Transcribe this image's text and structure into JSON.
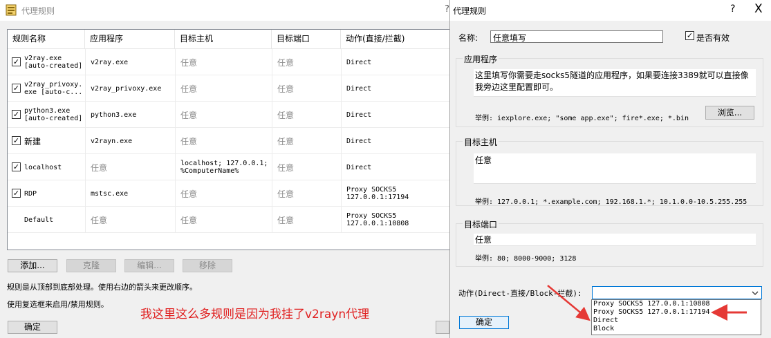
{
  "back_window": {
    "title": "代理规则",
    "help": "?",
    "columns": [
      "规则名称",
      "应用程序",
      "目标主机",
      "目标端口",
      "动作(直接/拦截)"
    ],
    "rows": [
      {
        "checked": true,
        "name": "v2ray.exe\n[auto-created]",
        "app": "v2ray.exe",
        "host": "任意",
        "port": "任意",
        "action": "Direct"
      },
      {
        "checked": true,
        "name": "v2ray_privoxy.\nexe [auto-c...",
        "app": "v2ray_privoxy.exe",
        "host": "任意",
        "port": "任意",
        "action": "Direct"
      },
      {
        "checked": true,
        "name": "python3.exe\n[auto-created]",
        "app": "python3.exe",
        "host": "任意",
        "port": "任意",
        "action": "Direct"
      },
      {
        "checked": true,
        "name": "新建",
        "app": "v2rayn.exe",
        "host": "任意",
        "port": "任意",
        "action": "Direct"
      },
      {
        "checked": true,
        "name": "localhost",
        "app": "任意",
        "host": "localhost; 127.0.0.1;\n%ComputerName%",
        "port": "任意",
        "action": "Direct"
      },
      {
        "checked": true,
        "name": "RDP",
        "app": "mstsc.exe",
        "host": "任意",
        "port": "任意",
        "action": "Proxy SOCKS5\n127.0.0.1:17194"
      },
      {
        "checked": false,
        "name": "Default",
        "app": "任意",
        "host": "任意",
        "port": "任意",
        "action": "Proxy SOCKS5\n127.0.0.1:10808"
      }
    ],
    "buttons": {
      "add": "添加...",
      "clone": "克隆",
      "edit": "编辑...",
      "remove": "移除",
      "ok": "确定"
    },
    "notes": [
      "规则是从顶部到底部处理。使用右边的箭头来更改顺序。",
      "使用复选框来启用/禁用规则。"
    ],
    "annotation": "我这里这么多规则是因为我挂了v2rayn代理"
  },
  "dialog": {
    "title": "代理规则",
    "help": "?",
    "close": "X",
    "name_label": "名称:",
    "name_value": "任意填写",
    "enabled_label": "是否有效",
    "enabled": true,
    "app_group": "应用程序",
    "app_value": "这里填写你需要走socks5隧道的应用程序，如果要连接3389就可以直接像我旁边这里配置即可。",
    "app_example": "举例: iexplore.exe; \"some app.exe\"; fire*.exe; *.bin",
    "browse_button": "浏览...",
    "host_group": "目标主机",
    "host_value": "任意",
    "host_example": "举例: 127.0.0.1; *.example.com; 192.168.1.*; 10.1.0.0-10.5.255.255",
    "port_group": "目标端口",
    "port_value": "任意",
    "port_example": "举例: 80; 8000-9000; 3128",
    "action_label": "动作(Direct-直接/Block-拦截):",
    "action_options": [
      "Proxy SOCKS5 127.0.0.1:10808",
      "Proxy SOCKS5 127.0.0.1:17194",
      "Direct",
      "Block"
    ],
    "ok_button": "确定"
  },
  "colors": {
    "annotation": "#e02020",
    "arrow": "#e53935",
    "selection": "#0078d7"
  },
  "icons": {
    "app": "app-icon",
    "checkbox": "checkmark-icon",
    "dropdown": "chevron-down-icon",
    "close": "close-icon"
  }
}
